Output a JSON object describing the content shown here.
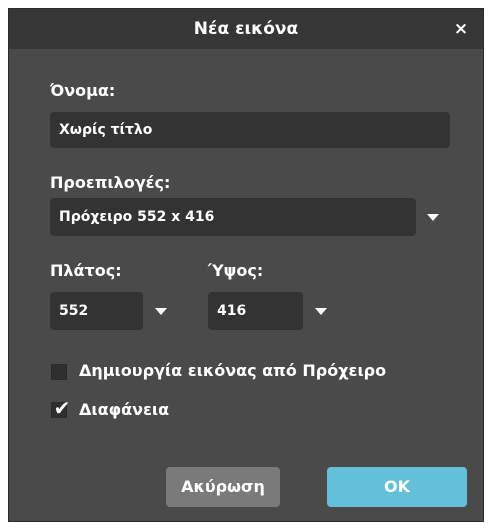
{
  "dialog": {
    "title": "Νέα εικόνα",
    "close_label": "×"
  },
  "name": {
    "label": "Όνομα:",
    "value": "Χωρίς τίτλο"
  },
  "presets": {
    "label": "Προεπιλογές:",
    "selected": "Πρόχειρο 552 x 416"
  },
  "width": {
    "label": "Πλάτος:",
    "value": "552"
  },
  "height": {
    "label": "Ύψος:",
    "value": "416"
  },
  "options": {
    "from_clipboard": {
      "label": "Δημιουργία εικόνας από Πρόχειρο",
      "checked": false
    },
    "transparency": {
      "label": "Διαφάνεια",
      "checked": true,
      "check_glyph": "✔"
    }
  },
  "buttons": {
    "cancel": "Ακύρωση",
    "ok": "OK"
  },
  "colors": {
    "dialog_bg": "#4a4a4a",
    "titlebar_bg": "#363636",
    "field_bg": "#333333",
    "cancel_bg": "#7a7a7a",
    "ok_bg": "#63c0d8"
  },
  "icons": {
    "dropdown": "chevron-down-icon",
    "close": "close-icon",
    "check": "checkmark-icon"
  }
}
